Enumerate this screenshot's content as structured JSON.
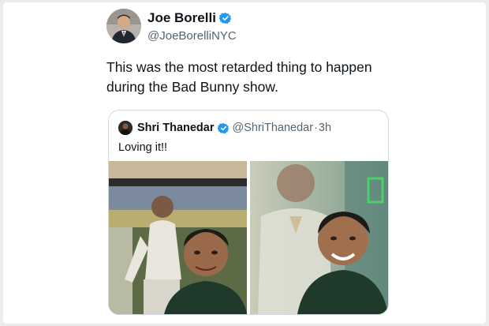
{
  "tweet": {
    "author_name": "Joe Borelli",
    "author_handle": "@JoeBorelliNYC",
    "text_line1": "This was the most retarded thing to happen",
    "text_line2": "during the Bad Bunny show."
  },
  "quote": {
    "author_name": "Shri Thanedar",
    "author_handle": "@ShriThanedar",
    "separator": "·",
    "time": "3h",
    "text": "Loving it!!"
  },
  "colors": {
    "verified": "#1d9bf0",
    "text_primary": "#0f1419",
    "text_secondary": "#536471",
    "border": "#cfd9de"
  }
}
